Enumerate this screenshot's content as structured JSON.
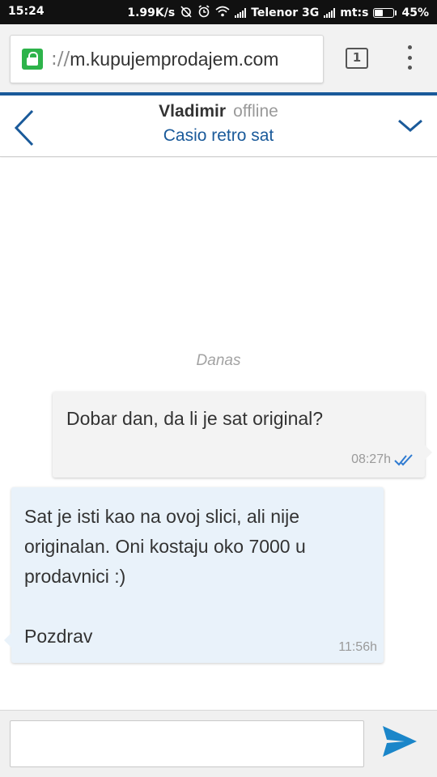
{
  "status_bar": {
    "time": "15:24",
    "network_speed": "1.99K/s",
    "carrier1": "Telenor 3G",
    "carrier2": "mt:s",
    "battery": "45%",
    "battery_level": 0.45,
    "icons": [
      "alarm-off-icon",
      "alarm-clock-icon",
      "wifi-icon",
      "signal-icon"
    ]
  },
  "browser": {
    "url_scheme": "://",
    "url_host": "m.kupujemprodajem.com",
    "tab_count": "1",
    "secure": true,
    "accent_color": "#2db34a"
  },
  "chat_header": {
    "name": "Vladimir",
    "status": "offline",
    "subject": "Casio retro sat",
    "accent_color": "#1a5a9a"
  },
  "chat": {
    "date_separator": "Danas",
    "messages": [
      {
        "direction": "outgoing",
        "text": "Dobar dan, da li je sat original?",
        "time": "08:27h",
        "read": true
      },
      {
        "direction": "incoming",
        "lines": [
          "Sat je isti kao na ovoj slici, ali nije",
          "originalan. Oni kostaju oko 7000 u",
          "prodavnici :)",
          "",
          "Pozdrav"
        ],
        "time": "11:56h"
      }
    ]
  },
  "input_bar": {
    "value": "",
    "placeholder": ""
  }
}
